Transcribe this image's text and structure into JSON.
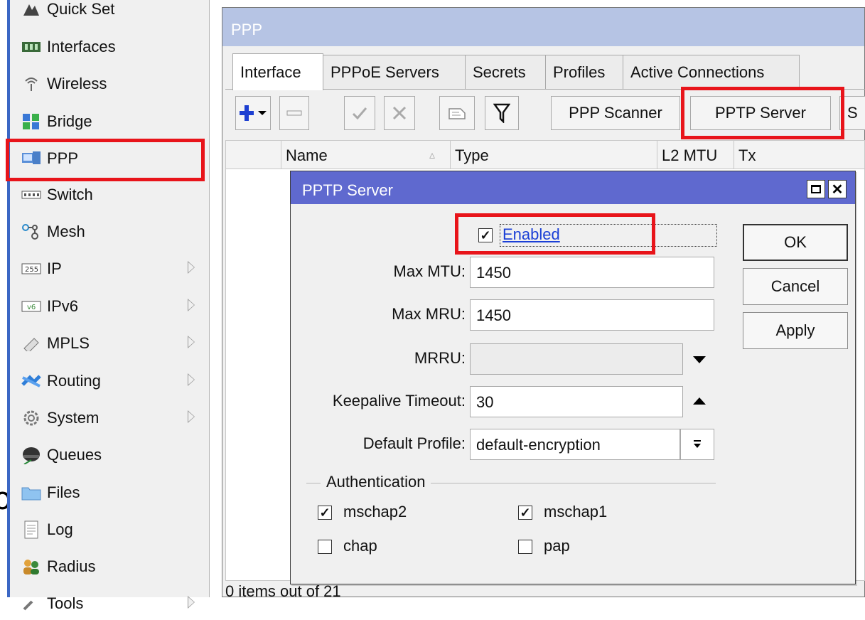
{
  "sidebar": {
    "items": [
      {
        "label": "Quick Set",
        "icon": "quick-set-icon",
        "submenu": false
      },
      {
        "label": "Interfaces",
        "icon": "interfaces-icon",
        "submenu": false
      },
      {
        "label": "Wireless",
        "icon": "wireless-icon",
        "submenu": false
      },
      {
        "label": "Bridge",
        "icon": "bridge-icon",
        "submenu": false
      },
      {
        "label": "PPP",
        "icon": "ppp-icon",
        "submenu": false
      },
      {
        "label": "Switch",
        "icon": "switch-icon",
        "submenu": false
      },
      {
        "label": "Mesh",
        "icon": "mesh-icon",
        "submenu": false
      },
      {
        "label": "IP",
        "icon": "ip-icon",
        "submenu": true
      },
      {
        "label": "IPv6",
        "icon": "ipv6-icon",
        "submenu": true
      },
      {
        "label": "MPLS",
        "icon": "mpls-icon",
        "submenu": true
      },
      {
        "label": "Routing",
        "icon": "routing-icon",
        "submenu": true
      },
      {
        "label": "System",
        "icon": "system-icon",
        "submenu": true
      },
      {
        "label": "Queues",
        "icon": "queues-icon",
        "submenu": false
      },
      {
        "label": "Files",
        "icon": "files-icon",
        "submenu": false
      },
      {
        "label": "Log",
        "icon": "log-icon",
        "submenu": false
      },
      {
        "label": "Radius",
        "icon": "radius-icon",
        "submenu": false
      },
      {
        "label": "Tools",
        "icon": "tools-icon",
        "submenu": true
      }
    ]
  },
  "ppp_window": {
    "title": "PPP",
    "tabs": [
      "Interface",
      "PPPoE Servers",
      "Secrets",
      "Profiles",
      "Active Connections"
    ],
    "active_tab": "Interface",
    "toolbar": {
      "ppp_scanner": "PPP Scanner",
      "pptp_server": "PPTP Server",
      "next_cut": "S"
    },
    "columns": [
      "Name",
      "Type",
      "L2 MTU",
      "Tx"
    ],
    "status": "0 items out of 21"
  },
  "dialog": {
    "title": "PPTP Server",
    "enabled_label": "Enabled",
    "enabled": true,
    "max_mtu_label": "Max MTU:",
    "max_mtu": "1450",
    "max_mru_label": "Max MRU:",
    "max_mru": "1450",
    "mrru_label": "MRRU:",
    "mrru": "",
    "keepalive_label": "Keepalive Timeout:",
    "keepalive": "30",
    "default_profile_label": "Default Profile:",
    "default_profile": "default-encryption",
    "auth_label": "Authentication",
    "auth": [
      {
        "label": "mschap2",
        "checked": true
      },
      {
        "label": "mschap1",
        "checked": true
      },
      {
        "label": "chap",
        "checked": false
      },
      {
        "label": "pap",
        "checked": false
      }
    ],
    "ok": "OK",
    "cancel": "Cancel",
    "apply": "Apply"
  },
  "left_cut_text": "o",
  "colors": {
    "title_active": "#5f69cf",
    "title_inactive": "#b6c4e4",
    "highlight": "#e8141a",
    "link": "#1a3fd6"
  }
}
